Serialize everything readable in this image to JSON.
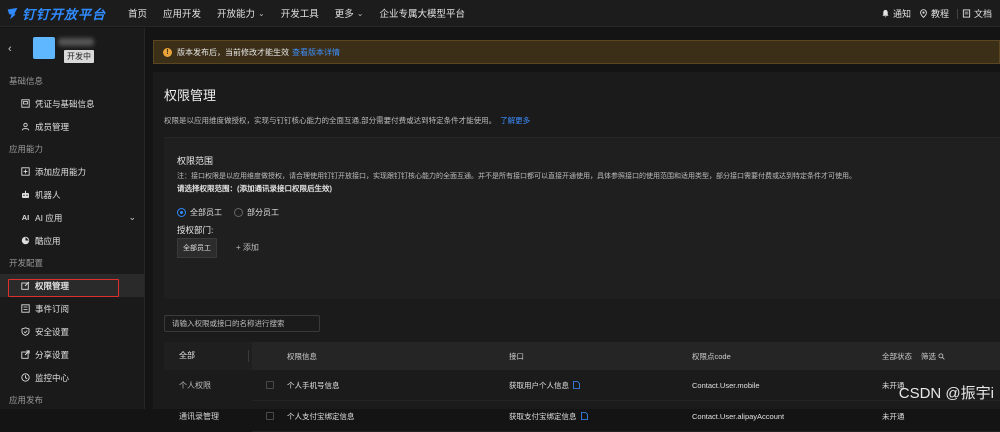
{
  "brand": {
    "name": "钉钉开放平台",
    "color": "#2f8bff"
  },
  "nav": {
    "items": [
      {
        "label": "首页",
        "has_menu": false
      },
      {
        "label": "应用开发",
        "has_menu": false
      },
      {
        "label": "开放能力",
        "has_menu": true
      },
      {
        "label": "开发工具",
        "has_menu": false
      },
      {
        "label": "更多",
        "has_menu": true
      },
      {
        "label": "企业专属大模型平台",
        "has_menu": false
      }
    ],
    "right": {
      "notify": "通知",
      "tutorial": "教程",
      "docs": "文档"
    }
  },
  "app": {
    "status_badge": "开发中"
  },
  "sidebar": {
    "sections": [
      {
        "title": "基础信息",
        "items": [
          {
            "label": "凭证与基础信息",
            "icon": "certificate-icon"
          },
          {
            "label": "成员管理",
            "icon": "user-icon"
          }
        ]
      },
      {
        "title": "应用能力",
        "items": [
          {
            "label": "添加应用能力",
            "icon": "add-box-icon"
          },
          {
            "label": "机器人",
            "icon": "robot-icon"
          },
          {
            "label": "AI 应用",
            "icon": "ai-icon",
            "expandable": true
          },
          {
            "label": "酷应用",
            "icon": "cool-app-icon"
          }
        ]
      },
      {
        "title": "开发配置",
        "items": [
          {
            "label": "权限管理",
            "icon": "permission-icon",
            "active": true
          },
          {
            "label": "事件订阅",
            "icon": "event-icon"
          },
          {
            "label": "安全设置",
            "icon": "shield-icon"
          },
          {
            "label": "分享设置",
            "icon": "share-icon"
          },
          {
            "label": "监控中心",
            "icon": "monitor-icon"
          }
        ]
      },
      {
        "title": "应用发布",
        "items": []
      }
    ]
  },
  "notice": {
    "text": "版本发布后，当前修改才能生效",
    "link": "查看版本详情",
    "color": "#e8a23a"
  },
  "page": {
    "title": "权限管理",
    "desc": "权限是以应用维度做授权，实现与钉钉核心能力的全面互通,部分需要付费或达到特定条件才能使用。",
    "learn_more": "了解更多"
  },
  "scope": {
    "title": "权限范围",
    "note": "注：接口权限是以应用维度做授权，请合理使用钉钉开放接口，实现跟钉钉核心能力的全面互通。并不是所有接口都可以直接开通使用，具体参照接口的使用范围和适用类型，部分接口需要付费或达到特定条件才可使用。",
    "select_label": "请选择权限范围：(添加通讯录接口权限后生效)",
    "options": [
      {
        "label": "全部员工",
        "selected": true
      },
      {
        "label": "部分员工",
        "selected": false
      }
    ],
    "dept_label": "授权部门:",
    "dept_tag": "全部员工",
    "add_label": "添加"
  },
  "search": {
    "placeholder": "请输入权限或接口的名称进行搜索"
  },
  "table": {
    "categories": [
      "全部",
      "个人权限",
      "通讯录管理"
    ],
    "headers": {
      "info": "权限信息",
      "api": "接口",
      "code": "权限点code",
      "status": "全部状态",
      "filter": "筛选"
    },
    "rows": [
      {
        "info": "个人手机号信息",
        "api": "获取用户个人信息",
        "code": "Contact.User.mobile",
        "status": "未开通"
      },
      {
        "info": "个人支付宝绑定信息",
        "api": "获取支付宝绑定信息",
        "code": "Contact.User.alipayAccount",
        "status": "未开通"
      }
    ]
  },
  "watermark": "CSDN @振宇i"
}
